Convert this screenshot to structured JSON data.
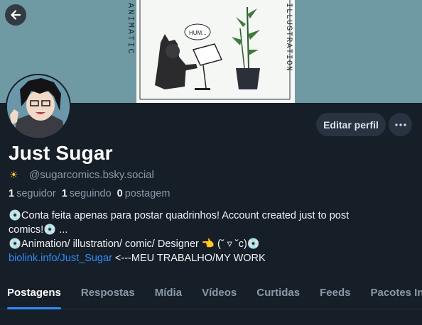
{
  "banner": {
    "left_vertical_text": "ANIMATIC",
    "right_vertical_text": "ILLUSTRATION",
    "speech_bubble": "HUM..."
  },
  "profile": {
    "display_name": "Just Sugar",
    "handle_emoji": "☀",
    "handle": "@sugarcomics.bsky.social",
    "edit_button": "Editar perfil",
    "more_button": "⋯"
  },
  "stats": {
    "followers_count": "1",
    "followers_label": "seguidor",
    "following_count": "1",
    "following_label": "seguindo",
    "posts_count": "0",
    "posts_label": "postagem"
  },
  "bio": {
    "line1": "💿Conta feita apenas para postar quadrinhos! Account created just to post",
    "line2": "comics!💿 ...",
    "line3": "💿Animation/ illustration/ comic/ Designer 👈 (˘ ▿ ˘c)💿",
    "link": "biolink.info/Just_Sugar",
    "link_suffix": " <---MEU TRABALHO/MY WORK"
  },
  "tabs": [
    {
      "label": "Postagens",
      "active": true
    },
    {
      "label": "Respostas"
    },
    {
      "label": "Mídia"
    },
    {
      "label": "Vídeos"
    },
    {
      "label": "Curtidas"
    },
    {
      "label": "Feeds"
    },
    {
      "label": "Pacotes Ini"
    }
  ],
  "colors": {
    "background": "#161e27",
    "banner_teal": "#6f9aa3",
    "accent_blue": "#2f8cff",
    "muted_text": "#8a98a8"
  }
}
